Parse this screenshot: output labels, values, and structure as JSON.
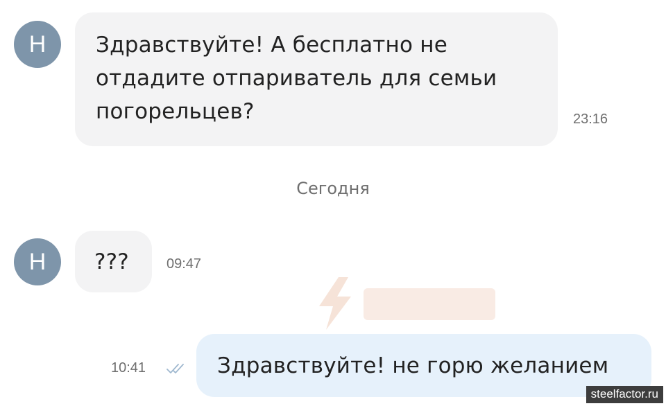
{
  "conversation": {
    "messages": [
      {
        "direction": "incoming",
        "avatar_letter": "Н",
        "text": "Здравствуйте! А бесплатно не\nотдадите отпариватель для семьи\nпогорельцев?",
        "time": "23:16"
      },
      {
        "direction": "incoming",
        "avatar_letter": "Н",
        "text": "???",
        "time": "09:47"
      },
      {
        "direction": "outgoing",
        "text": "Здравствуйте! не горю желанием",
        "time": "10:41",
        "status_icon": "double-check-icon"
      }
    ],
    "date_divider": "Сегодня"
  },
  "watermark": {
    "icon": "lightning-logo-icon",
    "color": "#f6e3d8"
  },
  "footer": {
    "site": "steelfactor.ru"
  },
  "colors": {
    "avatar": "#7e95aa",
    "incoming_bubble": "#f3f3f4",
    "outgoing_bubble": "#e6f1fb",
    "read_check": "#9fb8cf"
  }
}
